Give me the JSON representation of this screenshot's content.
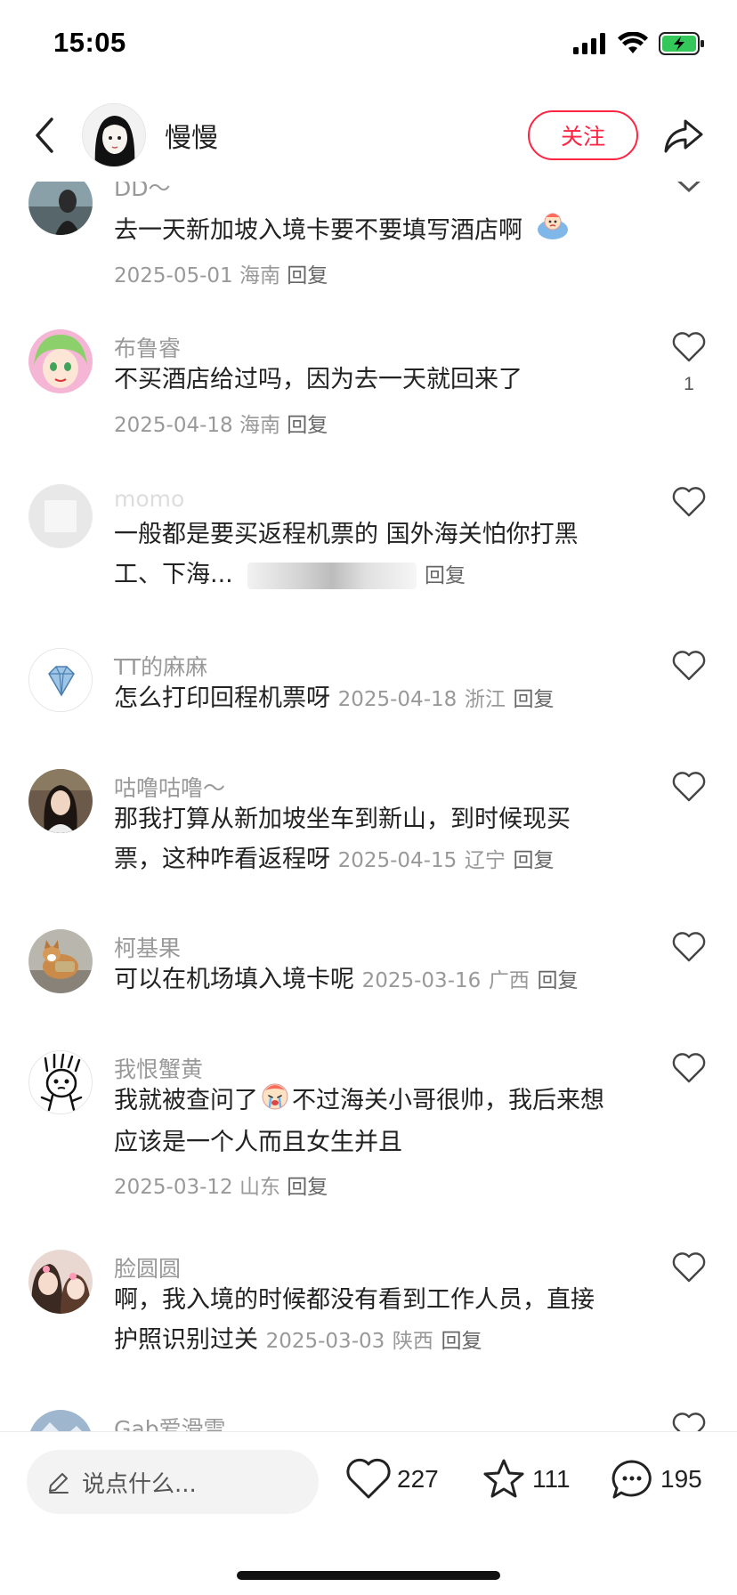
{
  "status_bar": {
    "time": "15:05"
  },
  "header": {
    "author_name": "慢慢",
    "follow_label": "关注"
  },
  "comments": [
    {
      "name": "DD～",
      "text": "去一天新加坡入境卡要不要填写酒店啊",
      "date": "2025-05-01",
      "location": "海南",
      "reply": "回复"
    },
    {
      "name": "布鲁睿",
      "text": "不买酒店给过吗，因为去一天就回来了",
      "date": "2025-04-18",
      "location": "海南",
      "reply": "回复",
      "likes": "1"
    },
    {
      "name": "momo",
      "text_line1": "一般都是要买返程机票的 国外海关怕你打黑",
      "text_line2": "工、下海...",
      "reply": "回复"
    },
    {
      "name": "TT的麻麻",
      "text": "怎么打印回程机票呀",
      "date": "2025-04-18",
      "location": "浙江",
      "reply": "回复"
    },
    {
      "name": "咕噜咕噜～",
      "text_line1": "那我打算从新加坡坐车到新山，到时候现买",
      "text_line2": "票，这种咋看返程呀",
      "date": "2025-04-15",
      "location": "辽宁",
      "reply": "回复"
    },
    {
      "name": "柯基果",
      "text": "可以在机场填入境卡呢",
      "date": "2025-03-16",
      "location": "广西",
      "reply": "回复"
    },
    {
      "name": "我恨蟹黄",
      "text_line1a": "我就被查问了",
      "text_line1b": "不过海关小哥很帅，我后来想",
      "text_line2": "应该是一个人而且女生并且",
      "date": "2025-03-12",
      "location": "山东",
      "reply": "回复"
    },
    {
      "name": "脸圆圆",
      "text_line1": "啊，我入境的时候都没有看到工作人员，直接",
      "text_line2": "护照识别过关",
      "date": "2025-03-03",
      "location": "陕西",
      "reply": "回复"
    },
    {
      "name": "Gab爱滑雪"
    }
  ],
  "bottom_bar": {
    "input_placeholder": "说点什么...",
    "likes_count": "227",
    "collects_count": "111",
    "comments_count": "195"
  },
  "colors": {
    "accent": "#ff2442",
    "secondary_text": "#999999",
    "primary_text": "#222222"
  }
}
